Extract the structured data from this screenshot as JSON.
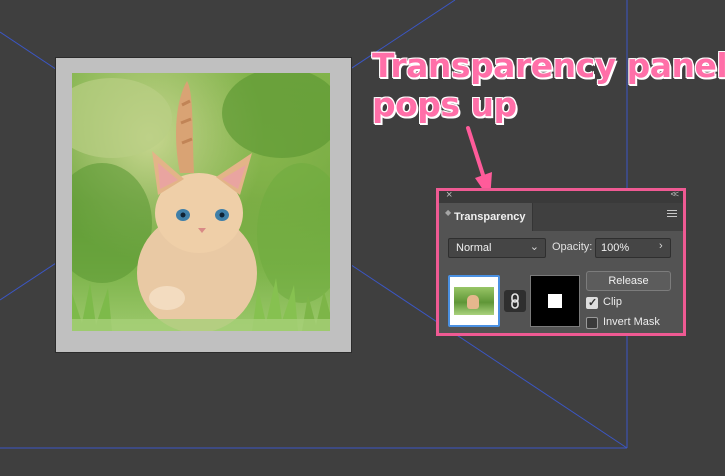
{
  "annotation": {
    "line1": "Transparency panel",
    "line2": "pops up",
    "color": "#ff6fa8"
  },
  "artwork": {
    "subject": "orange kitten in grass photo",
    "frame_color": "#c0c0c0",
    "guide_color": "#3b56c4"
  },
  "panel": {
    "close_glyph": "×",
    "collapse_glyph": "<<",
    "tab_label": "Transparency",
    "menu_icon": "hamburger-menu-icon",
    "blend_mode": "Normal",
    "opacity_label": "Opacity:",
    "opacity_value": "100%",
    "opacity_arrow": "›",
    "release_label": "Release",
    "clip_label": "Clip",
    "clip_checked": true,
    "invert_mask_label": "Invert Mask",
    "invert_mask_checked": false,
    "border_color": "#ef5a93"
  }
}
